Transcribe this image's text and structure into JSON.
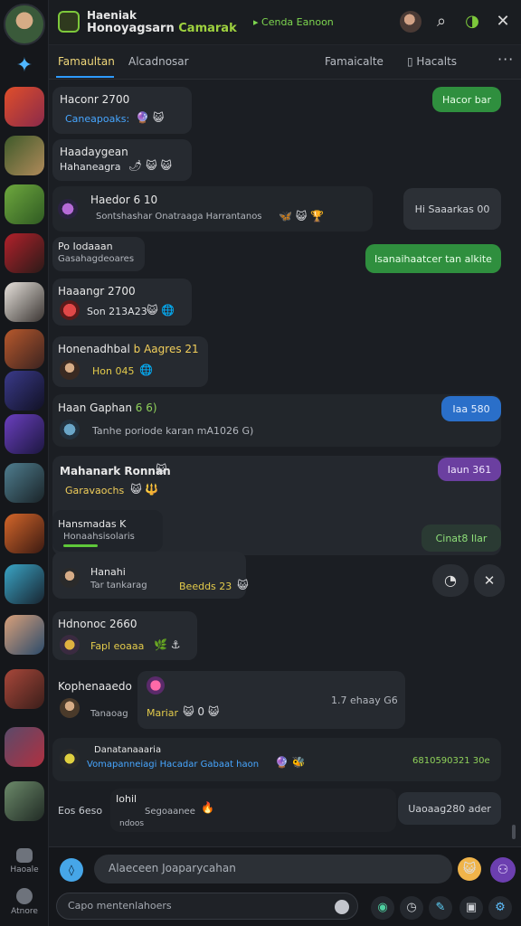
{
  "header": {
    "title_line1": "Haeniak",
    "title_line2_main": "Honoyagsarn ",
    "title_line2_accent": "Camarak",
    "status": "Cenda Eanoon"
  },
  "tabs": [
    {
      "label": "Famaultan",
      "active": true
    },
    {
      "label": "Alcadnosar",
      "active": false
    },
    {
      "label": "Famaicalte",
      "active": false
    },
    {
      "label": "Hacalts",
      "active": false
    }
  ],
  "tab_more": "···",
  "messages": [
    {
      "name": "Haconr 2700",
      "sub": "Caneapoaks:",
      "emoji": "🔮 😺"
    },
    {
      "name": "Haadaygean",
      "sub": "Hahaneagra",
      "emoji": "🌶 😺 😺"
    },
    {
      "name": "Haedor 6 10",
      "sub": "Sontshashar Onatraaga Harrantanos",
      "emoji": "🦋 😺 🏆"
    },
    {
      "name": "Po Iodaaan",
      "sub": "Gasahagdeoares"
    },
    {
      "name": "Haaangr 2700",
      "sub": "Son 213A23",
      "emoji": "😺 🌐"
    },
    {
      "name": "Honenadhbal",
      "name_accent": " b Aagres 21",
      "sub": "Hon 045",
      "emoji": "🌐"
    },
    {
      "name": "Haan Gaphan",
      "name_accent": " 6 6)",
      "sub": "Tanhe poriode karan  mA1026 G)"
    },
    {
      "name": "Mahanark Ronnan",
      "sub": "Garavaochs",
      "emoji": "😺 🔱"
    },
    {
      "name": "Hansmadas K",
      "sub": "Honaahsisolaris"
    },
    {
      "name": "Hanahi",
      "sub": "Tar tankarag",
      "extra": "Beedds 23",
      "emoji": "😺"
    },
    {
      "name": "Hdnonoc 2660",
      "sub": "Fapl eoaaa",
      "emoji": "🌿 ⚓"
    },
    {
      "name": "Kophenaaedo",
      "sub": "Tanaoag",
      "extra": "Mariar",
      "extra2": "1.7 ehaay G6",
      "emoji": "😺 0 😺"
    },
    {
      "name": "Danatanaaaria",
      "sub": "Vomapanneiagi Hacadar Gabaat haon",
      "extra": "6810590321 30e",
      "emoji": "🔮 🐝"
    },
    {
      "name": "Eos 6eso",
      "name2": "Iohil",
      "sub": "Segoaanee",
      "sub2": "ndoos",
      "extra": "Uaoaag280 ader",
      "emoji": "🔥"
    }
  ],
  "bubbles": [
    {
      "label": "Hacor bar",
      "color": "#2f8f3e"
    },
    {
      "label": "Hi Saaarkas 00",
      "color": "#2c3036"
    },
    {
      "label": "Isanaihaatcer tan alkite",
      "color": "#2f8f3e"
    },
    {
      "label": "Iaa 580",
      "color": "#2a6fc9"
    },
    {
      "label": "Iaun 361",
      "color": "#6b3fa0"
    },
    {
      "label": "Cinat8 Ilar",
      "color": "#2a3a33"
    }
  ],
  "rail": {
    "bottom_1": "Haoale",
    "bottom_2": "Atnore"
  },
  "composer": {
    "input_placeholder": "Alaeceen Joaparycahan",
    "search_placeholder": "Capo mentenlahoers"
  },
  "colors": {
    "accent_green": "#7dc83b",
    "accent_blue": "#2e9bff",
    "panel": "#262a30",
    "background": "#1b1e23"
  }
}
